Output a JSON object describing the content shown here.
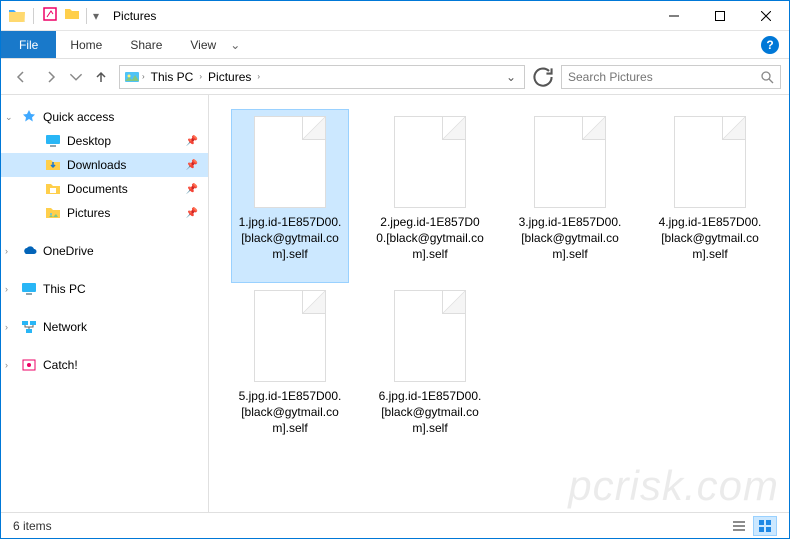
{
  "titlebar": {
    "title": "Pictures"
  },
  "ribbon": {
    "file": "File",
    "tabs": [
      "Home",
      "Share",
      "View"
    ]
  },
  "breadcrumb": {
    "segments": [
      "This PC",
      "Pictures"
    ]
  },
  "search": {
    "placeholder": "Search Pictures"
  },
  "sidebar": {
    "quick_access": {
      "label": "Quick access",
      "items": [
        {
          "label": "Desktop",
          "pinned": true
        },
        {
          "label": "Downloads",
          "pinned": true,
          "selected": true
        },
        {
          "label": "Documents",
          "pinned": true
        },
        {
          "label": "Pictures",
          "pinned": true
        }
      ]
    },
    "roots": [
      {
        "label": "OneDrive"
      },
      {
        "label": "This PC"
      },
      {
        "label": "Network"
      },
      {
        "label": "Catch!"
      }
    ]
  },
  "files": [
    {
      "name": "1.jpg.id-1E857D00.[black@gytmail.com].self",
      "selected": true
    },
    {
      "name": "2.jpeg.id-1E857D00.[black@gytmail.com].self"
    },
    {
      "name": "3.jpg.id-1E857D00.[black@gytmail.com].self"
    },
    {
      "name": "4.jpg.id-1E857D00.[black@gytmail.com].self"
    },
    {
      "name": "5.jpg.id-1E857D00.[black@gytmail.com].self"
    },
    {
      "name": "6.jpg.id-1E857D00.[black@gytmail.com].self"
    }
  ],
  "statusbar": {
    "count_label": "6 items"
  },
  "watermark": "pcrisk.com"
}
